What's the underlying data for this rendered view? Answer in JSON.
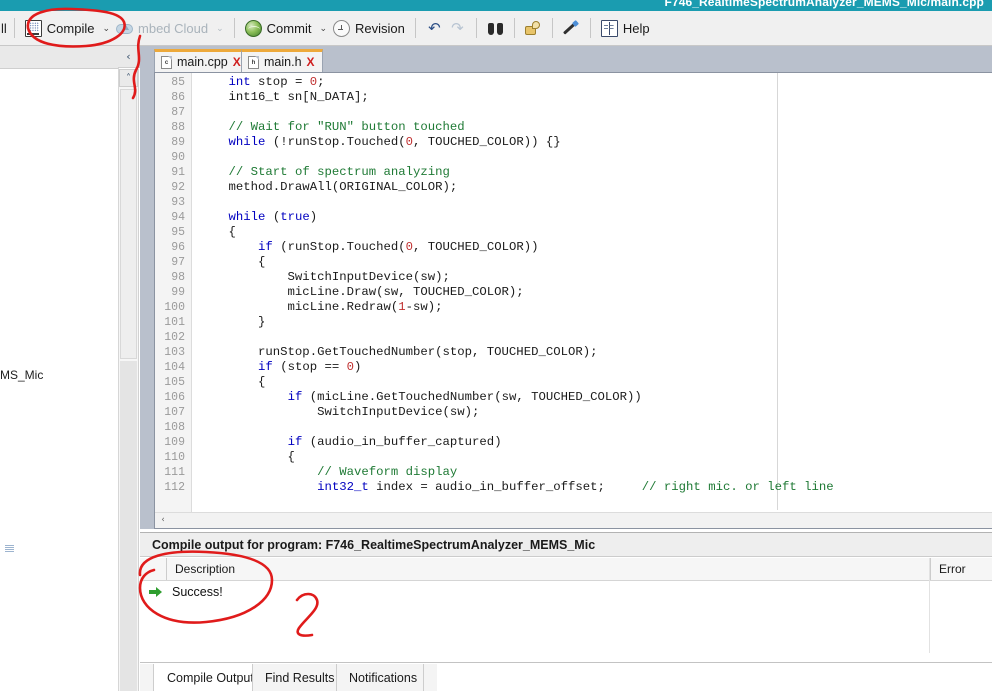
{
  "titlebar": {
    "title": "F746_RealtimeSpectrumAnalyzer_MEMS_Mic/main.cpp"
  },
  "toolbar": {
    "clipped_left_label": "ll",
    "compile_label": "Compile",
    "compile_caret": "⌄",
    "cloud_label": "mbed Cloud",
    "cloud_caret": "⌄",
    "commit_label": "Commit",
    "commit_caret": "⌄",
    "revision_label": "Revision",
    "undo_glyph": "↶",
    "redo_glyph": "↷",
    "help_label": "Help"
  },
  "left_panel": {
    "truncated_item": "MS_Mic",
    "collapse_glyph": "‹",
    "scroll_up_glyph": "˄"
  },
  "editor": {
    "tabs": [
      {
        "name": "main.cpp",
        "badge": "c",
        "close": "X"
      },
      {
        "name": "main.h",
        "badge": "h",
        "close": "X"
      }
    ],
    "hscroll_left_glyph": "‹",
    "lines": [
      {
        "n": "85",
        "segs": [
          {
            "t": "    ",
            "c": ""
          },
          {
            "t": "int",
            "c": "kw"
          },
          {
            "t": " stop = ",
            "c": ""
          },
          {
            "t": "0",
            "c": "num"
          },
          {
            "t": ";",
            "c": ""
          }
        ]
      },
      {
        "n": "86",
        "segs": [
          {
            "t": "    int16_t sn[N_DATA];",
            "c": ""
          }
        ]
      },
      {
        "n": "87",
        "segs": [
          {
            "t": "",
            "c": ""
          }
        ]
      },
      {
        "n": "88",
        "segs": [
          {
            "t": "    ",
            "c": ""
          },
          {
            "t": "// Wait for \"RUN\" button touched",
            "c": "cm"
          }
        ]
      },
      {
        "n": "89",
        "segs": [
          {
            "t": "    ",
            "c": ""
          },
          {
            "t": "while",
            "c": "kw"
          },
          {
            "t": " (!runStop.Touched(",
            "c": ""
          },
          {
            "t": "0",
            "c": "num"
          },
          {
            "t": ", TOUCHED_COLOR)) {}",
            "c": ""
          }
        ]
      },
      {
        "n": "90",
        "segs": [
          {
            "t": "",
            "c": ""
          }
        ]
      },
      {
        "n": "91",
        "segs": [
          {
            "t": "    ",
            "c": ""
          },
          {
            "t": "// Start of spectrum analyzing",
            "c": "cm"
          }
        ]
      },
      {
        "n": "92",
        "segs": [
          {
            "t": "    method.DrawAll(ORIGINAL_COLOR);",
            "c": ""
          }
        ]
      },
      {
        "n": "93",
        "segs": [
          {
            "t": "",
            "c": ""
          }
        ]
      },
      {
        "n": "94",
        "segs": [
          {
            "t": "    ",
            "c": ""
          },
          {
            "t": "while",
            "c": "kw"
          },
          {
            "t": " (",
            "c": ""
          },
          {
            "t": "true",
            "c": "kw"
          },
          {
            "t": ")",
            "c": ""
          }
        ]
      },
      {
        "n": "95",
        "segs": [
          {
            "t": "    {",
            "c": ""
          }
        ]
      },
      {
        "n": "96",
        "segs": [
          {
            "t": "        ",
            "c": ""
          },
          {
            "t": "if",
            "c": "kw"
          },
          {
            "t": " (runStop.Touched(",
            "c": ""
          },
          {
            "t": "0",
            "c": "num"
          },
          {
            "t": ", TOUCHED_COLOR))",
            "c": ""
          }
        ]
      },
      {
        "n": "97",
        "segs": [
          {
            "t": "        {",
            "c": ""
          }
        ]
      },
      {
        "n": "98",
        "segs": [
          {
            "t": "            SwitchInputDevice(sw);",
            "c": ""
          }
        ]
      },
      {
        "n": "99",
        "segs": [
          {
            "t": "            micLine.Draw(sw, TOUCHED_COLOR);",
            "c": ""
          }
        ]
      },
      {
        "n": "100",
        "segs": [
          {
            "t": "            micLine.Redraw(",
            "c": ""
          },
          {
            "t": "1",
            "c": "num"
          },
          {
            "t": "-sw);",
            "c": ""
          }
        ]
      },
      {
        "n": "101",
        "segs": [
          {
            "t": "        }",
            "c": ""
          }
        ]
      },
      {
        "n": "102",
        "segs": [
          {
            "t": "",
            "c": ""
          }
        ]
      },
      {
        "n": "103",
        "segs": [
          {
            "t": "        runStop.GetTouchedNumber(stop, TOUCHED_COLOR);",
            "c": ""
          }
        ]
      },
      {
        "n": "104",
        "segs": [
          {
            "t": "        ",
            "c": ""
          },
          {
            "t": "if",
            "c": "kw"
          },
          {
            "t": " (stop == ",
            "c": ""
          },
          {
            "t": "0",
            "c": "num"
          },
          {
            "t": ")",
            "c": ""
          }
        ]
      },
      {
        "n": "105",
        "segs": [
          {
            "t": "        {",
            "c": ""
          }
        ]
      },
      {
        "n": "106",
        "segs": [
          {
            "t": "            ",
            "c": ""
          },
          {
            "t": "if",
            "c": "kw"
          },
          {
            "t": " (micLine.GetTouchedNumber(sw, TOUCHED_COLOR))",
            "c": ""
          }
        ]
      },
      {
        "n": "107",
        "segs": [
          {
            "t": "                SwitchInputDevice(sw);",
            "c": ""
          }
        ]
      },
      {
        "n": "108",
        "segs": [
          {
            "t": "",
            "c": ""
          }
        ]
      },
      {
        "n": "109",
        "segs": [
          {
            "t": "            ",
            "c": ""
          },
          {
            "t": "if",
            "c": "kw"
          },
          {
            "t": " (audio_in_buffer_captured)",
            "c": ""
          }
        ]
      },
      {
        "n": "110",
        "segs": [
          {
            "t": "            {",
            "c": ""
          }
        ]
      },
      {
        "n": "111",
        "segs": [
          {
            "t": "                ",
            "c": ""
          },
          {
            "t": "// Waveform display",
            "c": "cm"
          }
        ]
      },
      {
        "n": "112",
        "segs": [
          {
            "t": "                ",
            "c": ""
          },
          {
            "t": "int32_t",
            "c": "kw"
          },
          {
            "t": " index = audio_in_buffer_offset;     ",
            "c": ""
          },
          {
            "t": "// right mic. or left line",
            "c": "cm"
          }
        ]
      }
    ]
  },
  "output": {
    "header": "Compile output for program: F746_RealtimeSpectrumAnalyzer_MEMS_Mic",
    "columns": {
      "description": "Description",
      "error": "Error"
    },
    "rows": [
      {
        "status_icon": "green-arrow-icon",
        "description": "Success!"
      }
    ],
    "tabs": [
      {
        "label": "Compile Output",
        "active": true
      },
      {
        "label": "Find Results",
        "active": false
      },
      {
        "label": "Notifications",
        "active": false
      }
    ]
  },
  "annotations": {
    "marker_one": "1",
    "marker_two": "2",
    "color": "#e01b1b"
  },
  "colors": {
    "titlebar": "#1a9cb0",
    "tab_accent": "#eda93b",
    "annotation_red": "#e01b1b",
    "success_green": "#2f9e2f"
  }
}
